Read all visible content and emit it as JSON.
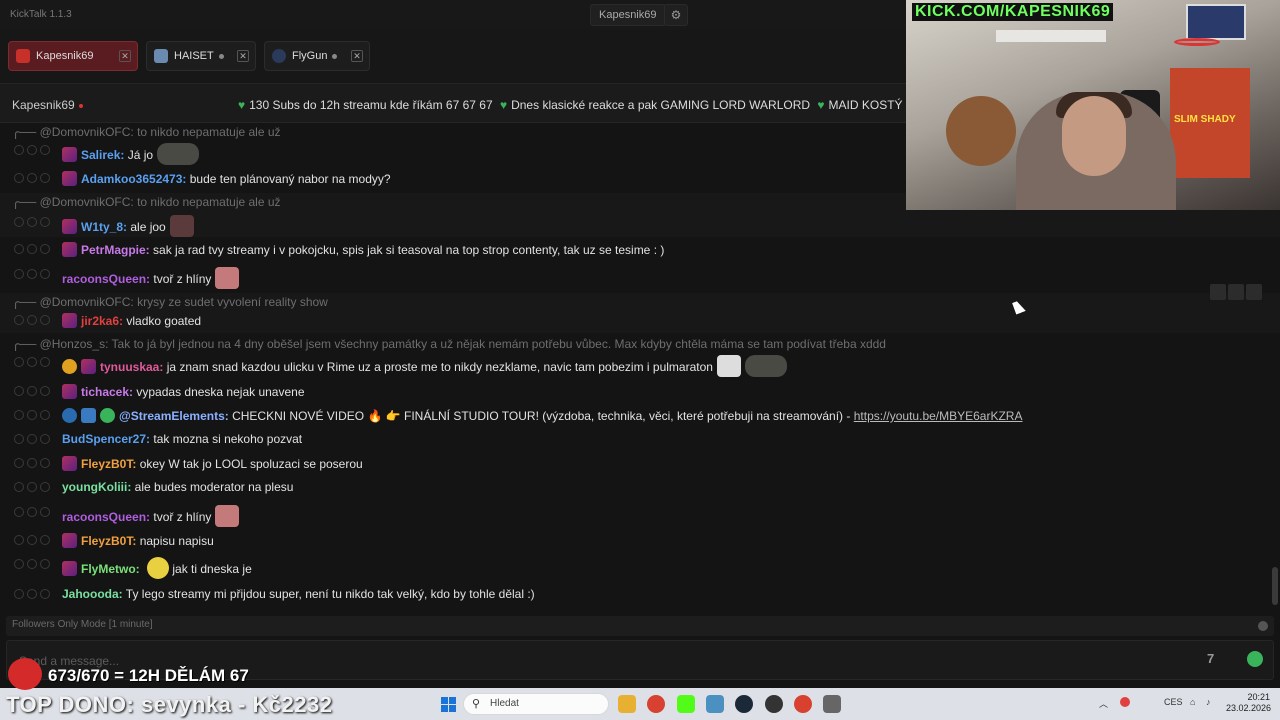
{
  "app": {
    "title": "KickTalk 1.1.3",
    "user": "Kapesnik69"
  },
  "tabs": [
    {
      "label": "Kapesnik69"
    },
    {
      "label": "HAISET"
    },
    {
      "label": "FlyGun"
    }
  ],
  "channel": {
    "name": "Kapesnik69",
    "ticker": [
      "130 Subs do 12h streamu kde říkám 67 67 67",
      "Dnes klasické reakce a pak GAMING LORD WARLORD",
      "MAID KOSTÝ"
    ]
  },
  "messages": [
    {
      "reply": "@DomovnikOFC: to nikdo nepamatuje ale už"
    },
    {
      "user": "Salirek:",
      "color": "#5aa0f0",
      "text": "Já jo"
    },
    {
      "user": "Adamkoo3652473:",
      "color": "#5aa0f0",
      "text": "bude ten plánovaný nabor na modyy?"
    },
    {
      "reply": "@DomovnikOFC: to nikdo nepamatuje ale už"
    },
    {
      "user": "W1ty_8:",
      "color": "#5aa0f0",
      "text": "ale joo"
    },
    {
      "user": "PetrMagpie:",
      "color": "#c87ae8",
      "text": "sak ja rad tvy streamy i v pokojcku, spis jak si teasoval na top strop contenty, tak uz se tesime : )"
    },
    {
      "user": "racoonsQueen:",
      "color": "#b05ee0",
      "text": "tvoř z hlíny"
    },
    {
      "reply": "@DomovnikOFC: krysy ze sudet vyvolení reality show"
    },
    {
      "user": "jir2ka6:",
      "color": "#e04040",
      "text": "vladko goated"
    },
    {
      "reply": "@Honzos_s: Tak to já byl jednou na 4 dny oběšel jsem všechny památky a už nějak nemám potřebu vůbec. Max kdyby chtěla máma se tam podívat třeba xddd"
    },
    {
      "user": "tynuuskaa:",
      "color": "#e05a9a",
      "text": "ja znam snad kazdou ulicku v Rime uz a proste me to nikdy nezklame, navic tam pobezim i pulmaraton"
    },
    {
      "user": "tichacek:",
      "color": "#c87ae8",
      "text": "vypadas dneska nejak unavene"
    },
    {
      "user": "@StreamElements:",
      "color": "#8ab0ff",
      "text": "CHECKNI NOVÉ VIDEO 🔥 👉 FINÁLNÍ STUDIO TOUR! (výzdoba, technika, věci, které potřebuji na streamování) -",
      "link": "https://youtu.be/MBYE6arKZRA"
    },
    {
      "user": "BudSpencer27:",
      "color": "#5aa0f0",
      "text": "tak mozna si nekoho pozvat"
    },
    {
      "user": "FleyzB0T:",
      "color": "#f0a040",
      "text": "okey W tak jo LOOL spoluzaci se poserou"
    },
    {
      "user": "youngKoliii:",
      "color": "#7ae0a0",
      "text": "ale budes moderator na plesu"
    },
    {
      "user": "racoonsQueen:",
      "color": "#b05ee0",
      "text": "tvoř z hlíny"
    },
    {
      "user": "FleyzB0T:",
      "color": "#f0a040",
      "text": "napisu napisu"
    },
    {
      "user": "FlyMetwo:",
      "color": "#7ae07a",
      "text": "jak ti dneska je"
    },
    {
      "user": "Jahoooda:",
      "color": "#7ae0a0",
      "text": "Ty lego streamy mi přijdou super, není tu nikdo tak velký, kdo by tohle dělal :)"
    }
  ],
  "footer": {
    "mode": "Followers Only Mode [1 minute]",
    "placeholder": "Send a message..."
  },
  "overlay": {
    "cam_title": "KICK.COM/KAPESNIK69",
    "poster": "SLIM SHADY",
    "goal": "673/670 = 12H DĚLÁM 67",
    "top_dono": "TOP DONO: sevynka - Kč2232"
  },
  "taskbar": {
    "search": "Hledat",
    "lang": "CES",
    "time": "20:21",
    "date": "23.02.2026"
  },
  "colors": {
    "accent": "#3ab45a",
    "active_tab": "#5a1c20",
    "background": "#141414"
  }
}
